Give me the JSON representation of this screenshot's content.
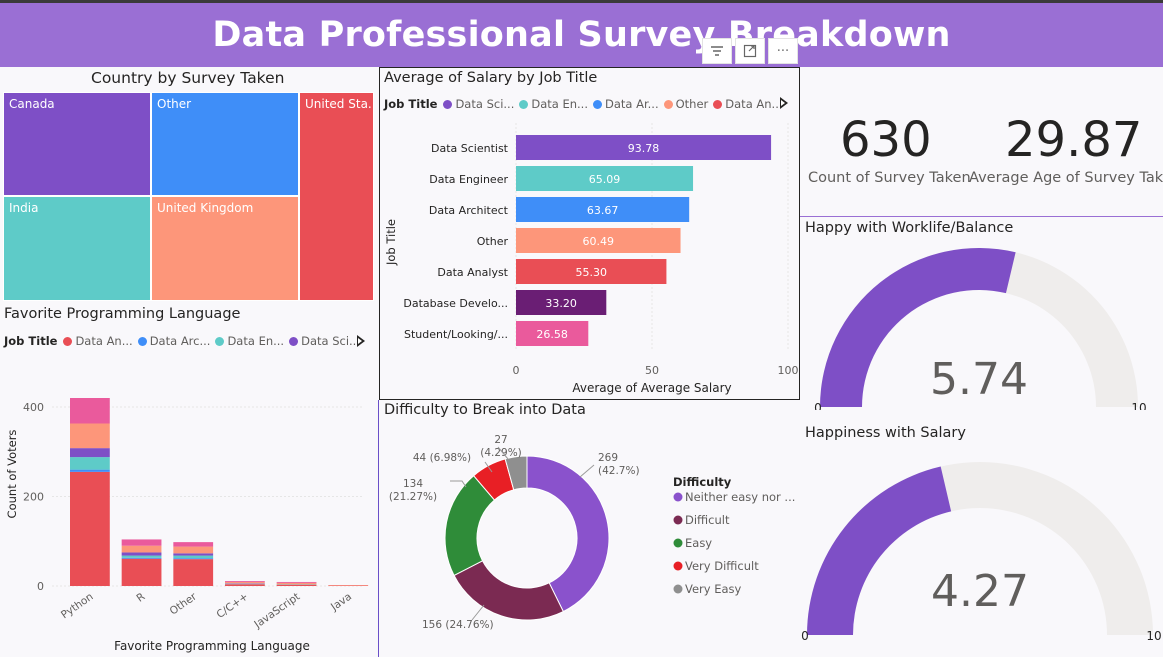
{
  "header": {
    "title": "Data Professional Survey Breakdown"
  },
  "visual_header": {
    "filter_icon": "filter-icon",
    "focus_icon": "focus-mode-icon",
    "more_icon": "more-options-icon",
    "more_label": "···"
  },
  "country": {
    "title": "Country by Survey Taken",
    "tiles": [
      {
        "label": "Canada",
        "color": "#7e4fc6"
      },
      {
        "label": "Other",
        "color": "#3f8ef8"
      },
      {
        "label": "United Sta...",
        "color": "#e94e55"
      },
      {
        "label": "India",
        "color": "#5ecbc8"
      },
      {
        "label": "United Kingdom",
        "color": "#fd967a"
      }
    ]
  },
  "language": {
    "title": "Favorite Programming Language",
    "legend_title": "Job Title",
    "legend": [
      {
        "label": "Data An...",
        "color": "#e94e55"
      },
      {
        "label": "Data Arc...",
        "color": "#3f8ef8"
      },
      {
        "label": "Data En...",
        "color": "#5ecbc8"
      },
      {
        "label": "Data Sci...",
        "color": "#7e4fc6"
      }
    ],
    "xlabel": "Favorite Programming Language",
    "ylabel": "Count of Voters"
  },
  "salary": {
    "title": "Average of Salary by Job Title",
    "legend_title": "Job Title",
    "legend": [
      {
        "label": "Data Sci...",
        "color": "#7e4fc6"
      },
      {
        "label": "Data En...",
        "color": "#5ecbc8"
      },
      {
        "label": "Data Ar...",
        "color": "#3f8ef8"
      },
      {
        "label": "Other",
        "color": "#fd967a"
      },
      {
        "label": "Data An...",
        "color": "#e94e55"
      }
    ],
    "xlabel": "Average of Average Salary",
    "ylabel": "Job Title"
  },
  "difficulty": {
    "title": "Difficulty to Break into Data",
    "legend_title": "Difficulty"
  },
  "cards": {
    "count_value": "630",
    "count_label": "Count of Survey Taken",
    "age_value": "29.87",
    "age_label": "Average Age of Survey Taken"
  },
  "gauge_worklife": {
    "title": "Happy with Worklife/Balance",
    "value": 5.74,
    "value_text": "5.74",
    "min": 0,
    "max": 10,
    "min_label": "0",
    "max_label": "10",
    "color": "#7e4fc6"
  },
  "gauge_salary": {
    "title": "Happiness with Salary",
    "value": 4.27,
    "value_text": "4.27",
    "min": 0,
    "max": 10,
    "min_label": "0",
    "max_label": "10",
    "color": "#7e4fc6"
  },
  "chart_data": [
    {
      "type": "treemap",
      "title": "Country by Survey Taken",
      "categories": [
        "United Sta...",
        "Other",
        "Canada",
        "India",
        "United Kingdom"
      ],
      "values": [
        262,
        168,
        168,
        110,
        110
      ]
    },
    {
      "type": "bar",
      "stacked": true,
      "title": "Favorite Programming Language",
      "categories": [
        "Python",
        "R",
        "Other",
        "C/C++",
        "JavaScript",
        "Java"
      ],
      "series": [
        {
          "name": "Data An...",
          "color": "#e94e55",
          "values": [
            255,
            61,
            60,
            4,
            3,
            1
          ]
        },
        {
          "name": "Data Arc...",
          "color": "#3f8ef8",
          "values": [
            5,
            2,
            2,
            0,
            0,
            0
          ]
        },
        {
          "name": "Data En...",
          "color": "#5ecbc8",
          "values": [
            28,
            5,
            6,
            1,
            1,
            0
          ]
        },
        {
          "name": "Data Sci...",
          "color": "#7e4fc6",
          "values": [
            20,
            7,
            5,
            1,
            0,
            0
          ]
        },
        {
          "name": "Other",
          "color": "#fd967a",
          "values": [
            55,
            15,
            15,
            3,
            3,
            1
          ]
        },
        {
          "name": "Student/Looking/...",
          "color": "#ea5a9c",
          "values": [
            57,
            14,
            10,
            2,
            2,
            0
          ]
        }
      ],
      "xlabel": "Favorite Programming Language",
      "ylabel": "Count of Voters",
      "ylim": [
        0,
        420
      ],
      "yticks": [
        0,
        200,
        400
      ]
    },
    {
      "type": "bar",
      "orientation": "horizontal",
      "title": "Average of Salary by Job Title",
      "categories": [
        "Data Scientist",
        "Data Engineer",
        "Data Architect",
        "Other",
        "Data Analyst",
        "Database Develo...",
        "Student/Looking/..."
      ],
      "values": [
        93.78,
        65.09,
        63.67,
        60.49,
        55.3,
        33.2,
        26.58
      ],
      "value_labels": [
        "93.78",
        "65.09",
        "63.67",
        "60.49",
        "55.30",
        "33.20",
        "26.58"
      ],
      "colors": [
        "#7e4fc6",
        "#5ecbc8",
        "#3f8ef8",
        "#fd967a",
        "#e94e55",
        "#6a1e74",
        "#ea5a9c"
      ],
      "xlabel": "Average of Average Salary",
      "ylabel": "Job Title",
      "xlim": [
        0,
        100
      ],
      "xticks": [
        0,
        50,
        100
      ]
    },
    {
      "type": "pie",
      "donut": true,
      "title": "Difficulty to Break into Data",
      "categories": [
        "Neither easy nor ...",
        "Difficult",
        "Easy",
        "Very Difficult",
        "Very Easy"
      ],
      "values": [
        269,
        156,
        134,
        44,
        27
      ],
      "labels": [
        {
          "count": "269",
          "pct": "(42.7%)"
        },
        {
          "count": "156",
          "pct": "(24.76%)"
        },
        {
          "count": "134",
          "pct": "(21.27%)"
        },
        {
          "count": "44",
          "pct": "(6.98%)"
        },
        {
          "count": "27",
          "pct": "(4.29%)"
        }
      ],
      "colors": [
        "#8a52cc",
        "#7b2a52",
        "#2f8c39",
        "#e81f25",
        "#8f8f8f"
      ]
    }
  ]
}
